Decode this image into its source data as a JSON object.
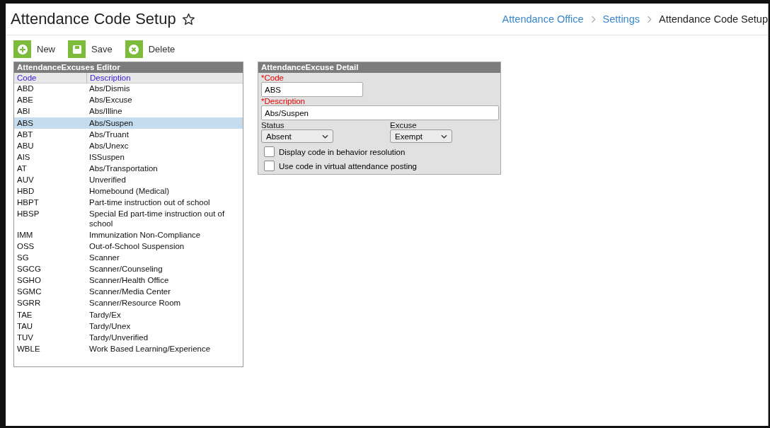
{
  "page": {
    "title": "Attendance Code Setup",
    "favorite": false
  },
  "breadcrumbs": [
    {
      "label": "Attendance Office",
      "link": true
    },
    {
      "label": "Settings",
      "link": true
    },
    {
      "label": "Attendance Code Setup",
      "link": false
    }
  ],
  "toolbar": [
    {
      "label": "New",
      "kind": "new"
    },
    {
      "label": "Save",
      "kind": "save"
    },
    {
      "label": "Delete",
      "kind": "delete"
    }
  ],
  "editor": {
    "title": "AttendanceExcuses Editor",
    "columns": [
      "Code",
      "Description"
    ],
    "rows": [
      {
        "code": "ABD",
        "description": "Abs/Dismis",
        "selected": false
      },
      {
        "code": "ABE",
        "description": "Abs/Excuse",
        "selected": false
      },
      {
        "code": "ABI",
        "description": "Abs/Illine",
        "selected": false
      },
      {
        "code": "ABS",
        "description": "Abs/Suspen",
        "selected": true
      },
      {
        "code": "ABT",
        "description": "Abs/Truant",
        "selected": false
      },
      {
        "code": "ABU",
        "description": "Abs/Unexc",
        "selected": false
      },
      {
        "code": "AIS",
        "description": "ISSuspen",
        "selected": false
      },
      {
        "code": "AT",
        "description": "Abs/Transportation",
        "selected": false
      },
      {
        "code": "AUV",
        "description": "Unverified",
        "selected": false
      },
      {
        "code": "HBD",
        "description": "Homebound (Medical)",
        "selected": false
      },
      {
        "code": "HBPT",
        "description": "Part-time instruction out of school",
        "selected": false
      },
      {
        "code": "HBSP",
        "description": "Special Ed part-time instruction out of school",
        "selected": false
      },
      {
        "code": "IMM",
        "description": "Immunization Non-Compliance",
        "selected": false
      },
      {
        "code": "OSS",
        "description": "Out-of-School Suspension",
        "selected": false
      },
      {
        "code": "SG",
        "description": "Scanner",
        "selected": false
      },
      {
        "code": "SGCG",
        "description": "Scanner/Counseling",
        "selected": false
      },
      {
        "code": "SGHO",
        "description": "Scanner/Health Office",
        "selected": false
      },
      {
        "code": "SGMC",
        "description": "Scanner/Media Center",
        "selected": false
      },
      {
        "code": "SGRR",
        "description": "Scanner/Resource Room",
        "selected": false
      },
      {
        "code": "TAE",
        "description": "Tardy/Ex",
        "selected": false
      },
      {
        "code": "TAU",
        "description": "Tardy/Unex",
        "selected": false
      },
      {
        "code": "TUV",
        "description": "Tardy/Unverified",
        "selected": false
      },
      {
        "code": "WBLE",
        "description": "Work Based Learning/Experience",
        "selected": false
      }
    ]
  },
  "detail": {
    "title": "AttendanceExcuse Detail",
    "code": {
      "label": "*Code",
      "value": "ABS"
    },
    "description": {
      "label": "*Description",
      "value": "Abs/Suspen"
    },
    "status": {
      "label": "Status",
      "value": "Absent"
    },
    "excuse": {
      "label": "Excuse",
      "value": "Exempt"
    },
    "options": [
      {
        "label": "Display code in behavior resolution",
        "checked": false
      },
      {
        "label": "Use code in virtual attendance posting",
        "checked": false
      }
    ]
  }
}
